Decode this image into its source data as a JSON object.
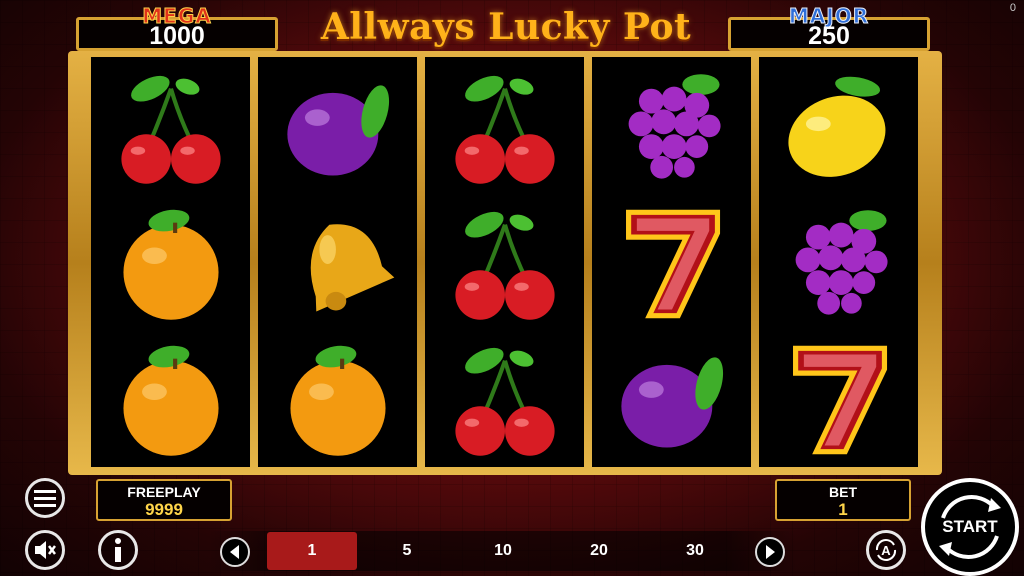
{
  "title": "Allways Lucky Pot",
  "jackpots": {
    "mega": {
      "label": "MEGA",
      "value": "1000"
    },
    "major": {
      "label": "MAJOR",
      "value": "250"
    }
  },
  "corner_indicator": "0",
  "reels": [
    [
      "cherry",
      "orange",
      "orange"
    ],
    [
      "plum",
      "bell",
      "orange"
    ],
    [
      "cherry",
      "cherry",
      "cherry"
    ],
    [
      "grapes",
      "seven",
      "plum"
    ],
    [
      "lemon",
      "grapes",
      "seven"
    ]
  ],
  "freeplay": {
    "label": "FREEPLAY",
    "value": "9999"
  },
  "bet": {
    "label": "BET",
    "value": "1"
  },
  "bet_options": [
    "1",
    "5",
    "10",
    "20",
    "30"
  ],
  "selected_bet": "1",
  "start_label": "START",
  "icons": {
    "menu": "hamburger-icon",
    "sound": "sound-muted-icon",
    "info": "info-icon",
    "autoplay": "autoplay-icon",
    "prev": "chevron-left-icon",
    "next": "chevron-right-icon"
  },
  "colors": {
    "frame_gold": "#d7a232",
    "title_gold": "#ffb21a",
    "selected_bet_bg": "#a81a1a",
    "mega_red": "#e0321a",
    "major_blue": "#2f6ed8"
  }
}
